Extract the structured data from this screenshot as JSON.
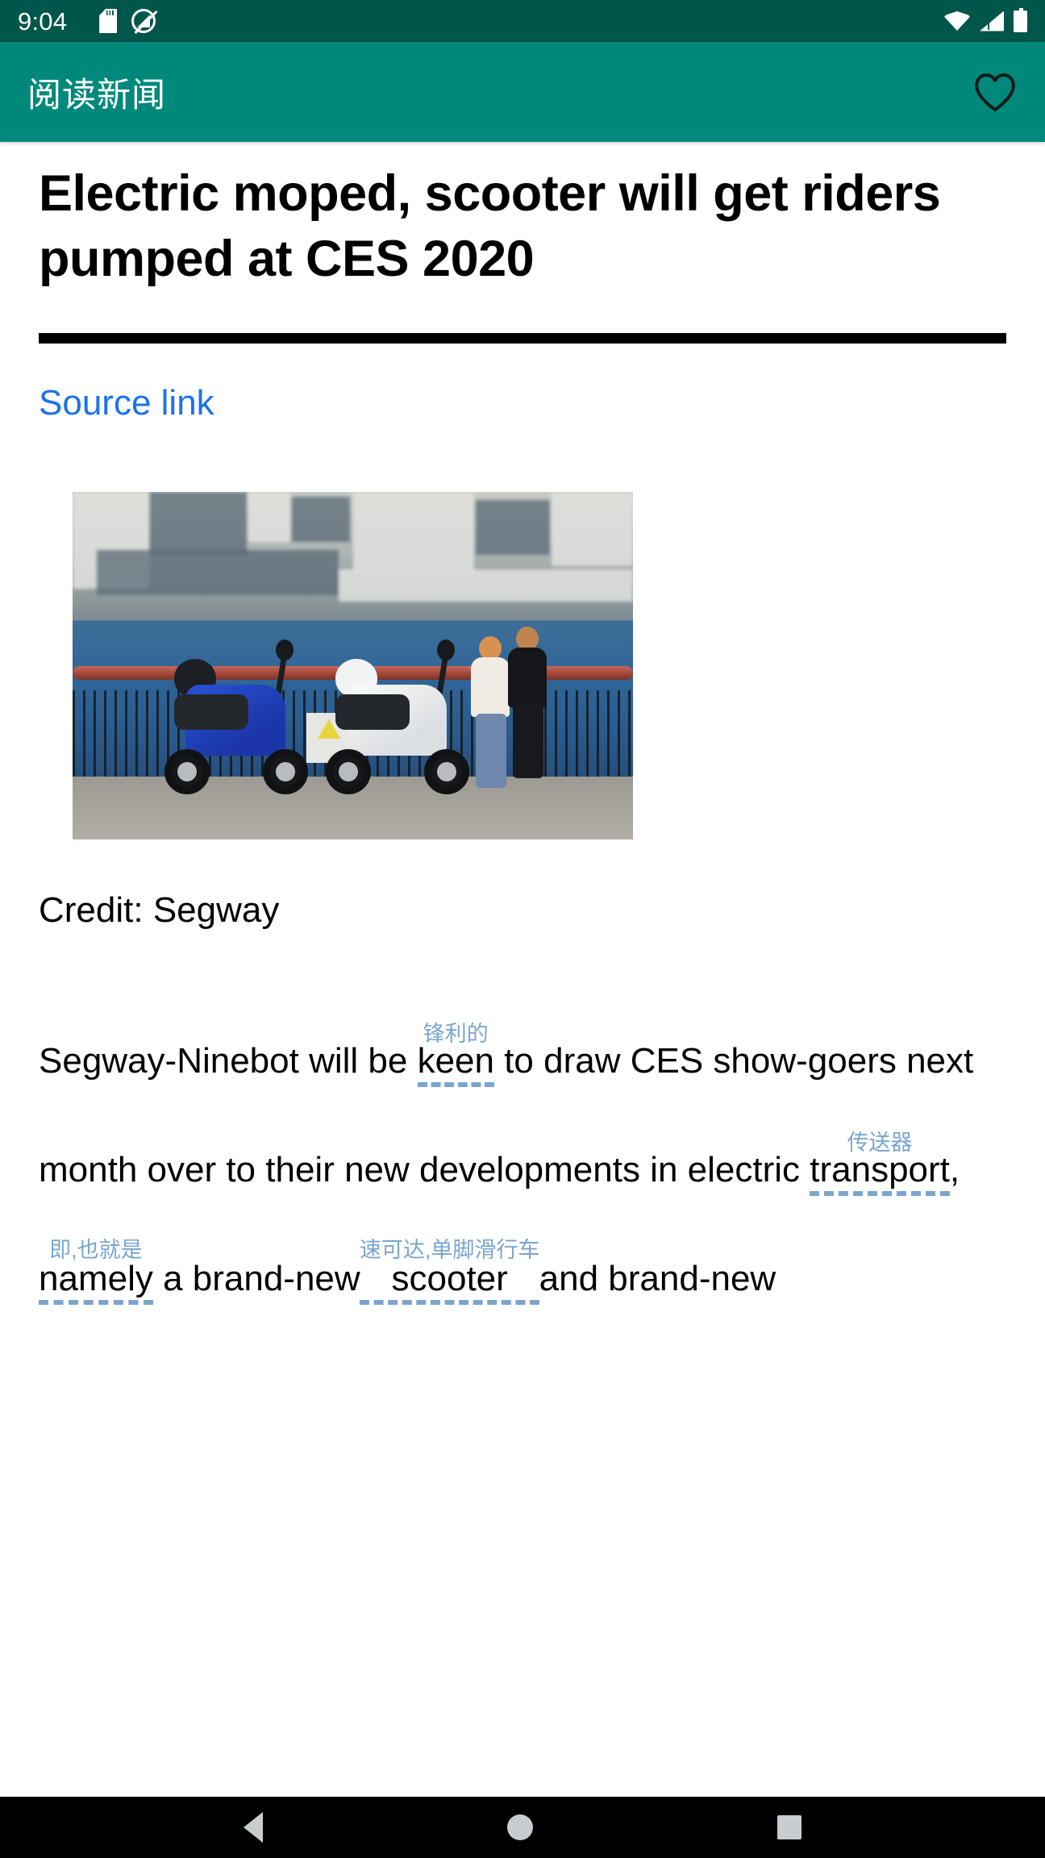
{
  "status_bar": {
    "time": "9:04",
    "icons_left": [
      "sd-card-icon",
      "sync-disabled-icon"
    ],
    "icons_right": [
      "wifi-icon",
      "signal-icon",
      "battery-icon"
    ],
    "background_color": "#00564a"
  },
  "app_bar": {
    "title": "阅读新闻",
    "favorite_icon": "heart-outline-icon",
    "background_color": "#00897b"
  },
  "article": {
    "title": "Electric moped, scooter will get riders pumped at CES 2020",
    "source_link_label": "Source link",
    "source_link_color": "#1a73e8",
    "image_caption": "Credit: Segway",
    "image_alt": "Blue and white electric mopeds parked at a waterfront railing with a couple standing nearby",
    "body_segments": [
      {
        "text": "Segway-Ninebot will be "
      },
      {
        "text": "keen",
        "annotation": "锋利的"
      },
      {
        "text": " to draw CES show-goers next month over to their new developments in electric "
      },
      {
        "text": "transport",
        "annotation": "传送器"
      },
      {
        "text": ", "
      },
      {
        "text": "namely",
        "annotation": "即,也就是"
      },
      {
        "text": " a brand-new "
      },
      {
        "text": "scooter",
        "annotation": "速可达,单脚滑行车"
      },
      {
        "text": " and brand-new"
      }
    ],
    "annotation_color": "#7aa5cf"
  },
  "nav_bar": {
    "back_icon": "back-triangle-icon",
    "home_icon": "home-circle-icon",
    "recents_icon": "recents-square-icon",
    "background_color": "#000000"
  }
}
